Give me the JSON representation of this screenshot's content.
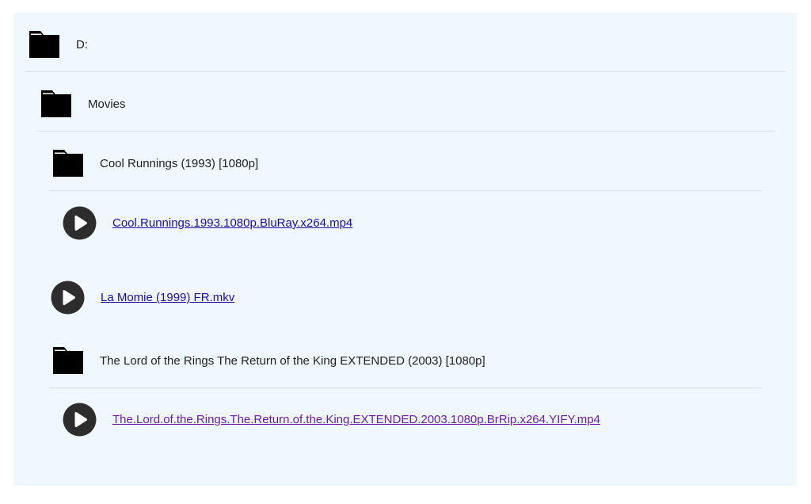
{
  "tree": {
    "root": {
      "label": "D:",
      "icon": "folder-icon"
    },
    "movies": {
      "label": "Movies",
      "icon": "folder-icon"
    },
    "cool_runnings_folder": {
      "label": "Cool Runnings (1993) [1080p]",
      "icon": "folder-icon"
    },
    "cool_runnings_file": {
      "label": "Cool.Runnings.1993.1080p.BluRay.x264.mp4",
      "icon": "play-icon"
    },
    "la_momie_file": {
      "label": "La Momie (1999) FR.mkv",
      "icon": "play-icon"
    },
    "lotr_folder": {
      "label": "The Lord of the Rings The Return of the King EXTENDED (2003) [1080p]",
      "icon": "folder-icon"
    },
    "lotr_file": {
      "label": "The.Lord.of.the.Rings.The.Return.of.the.King.EXTENDED.2003.1080p.BrRip.x264.YIFY.mp4",
      "icon": "play-icon"
    }
  },
  "colors": {
    "panel_background": "#f0f8ff",
    "link": "#1a0dab",
    "visited_link": "#681da8",
    "icon": "#000000",
    "play_icon": "#2d2d2d"
  }
}
